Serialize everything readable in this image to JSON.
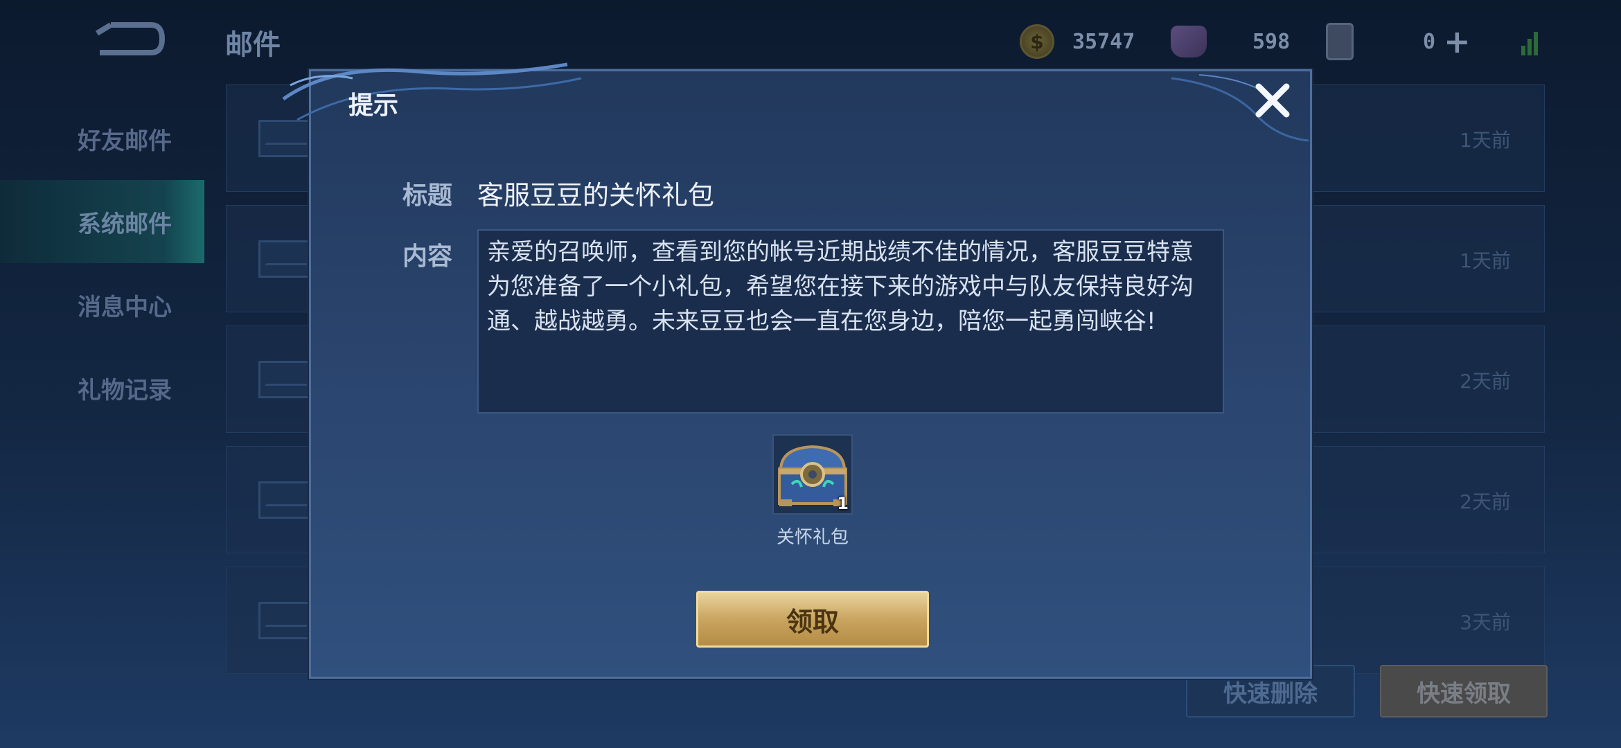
{
  "header": {
    "page_title": "邮件",
    "gold": "35747",
    "gems": "598",
    "cards": "0"
  },
  "sidebar": {
    "items": [
      {
        "label": "好友邮件"
      },
      {
        "label": "系统邮件"
      },
      {
        "label": "消息中心"
      },
      {
        "label": "礼物记录"
      }
    ]
  },
  "mail_list": {
    "rows": [
      {
        "time": "1天前"
      },
      {
        "time": "1天前"
      },
      {
        "time": "2天前"
      },
      {
        "time": "2天前"
      },
      {
        "time": "3天前"
      }
    ]
  },
  "actions": {
    "quick_delete": "快速删除",
    "quick_claim": "快速领取"
  },
  "dialog": {
    "title": "提示",
    "subject_label": "标题",
    "subject": "客服豆豆的关怀礼包",
    "content_label": "内容",
    "content": "亲爱的召唤师，查看到您的帐号近期战绩不佳的情况，客服豆豆特意为您准备了一个小礼包，希望您在接下来的游戏中与队友保持良好沟通、越战越勇。未来豆豆也会一直在您身边，陪您一起勇闯峡谷!",
    "attachment": {
      "name": "关怀礼包",
      "quantity": "1"
    },
    "claim_button": "领取"
  }
}
